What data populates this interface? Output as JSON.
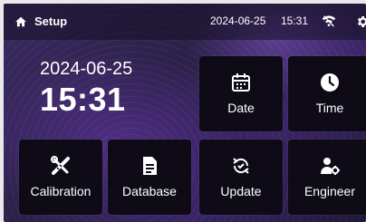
{
  "header": {
    "title": "Setup",
    "date": "2024-06-25",
    "time": "15:31"
  },
  "clock": {
    "date": "2024-06-25",
    "time": "15:31"
  },
  "tiles": [
    {
      "label": "Date",
      "icon": "calendar-icon"
    },
    {
      "label": "Time",
      "icon": "clock-icon"
    },
    {
      "label": "Calibration",
      "icon": "tools-icon"
    },
    {
      "label": "Database",
      "icon": "database-icon"
    },
    {
      "label": "Update",
      "icon": "update-icon"
    },
    {
      "label": "Engineer",
      "icon": "engineer-icon"
    }
  ]
}
